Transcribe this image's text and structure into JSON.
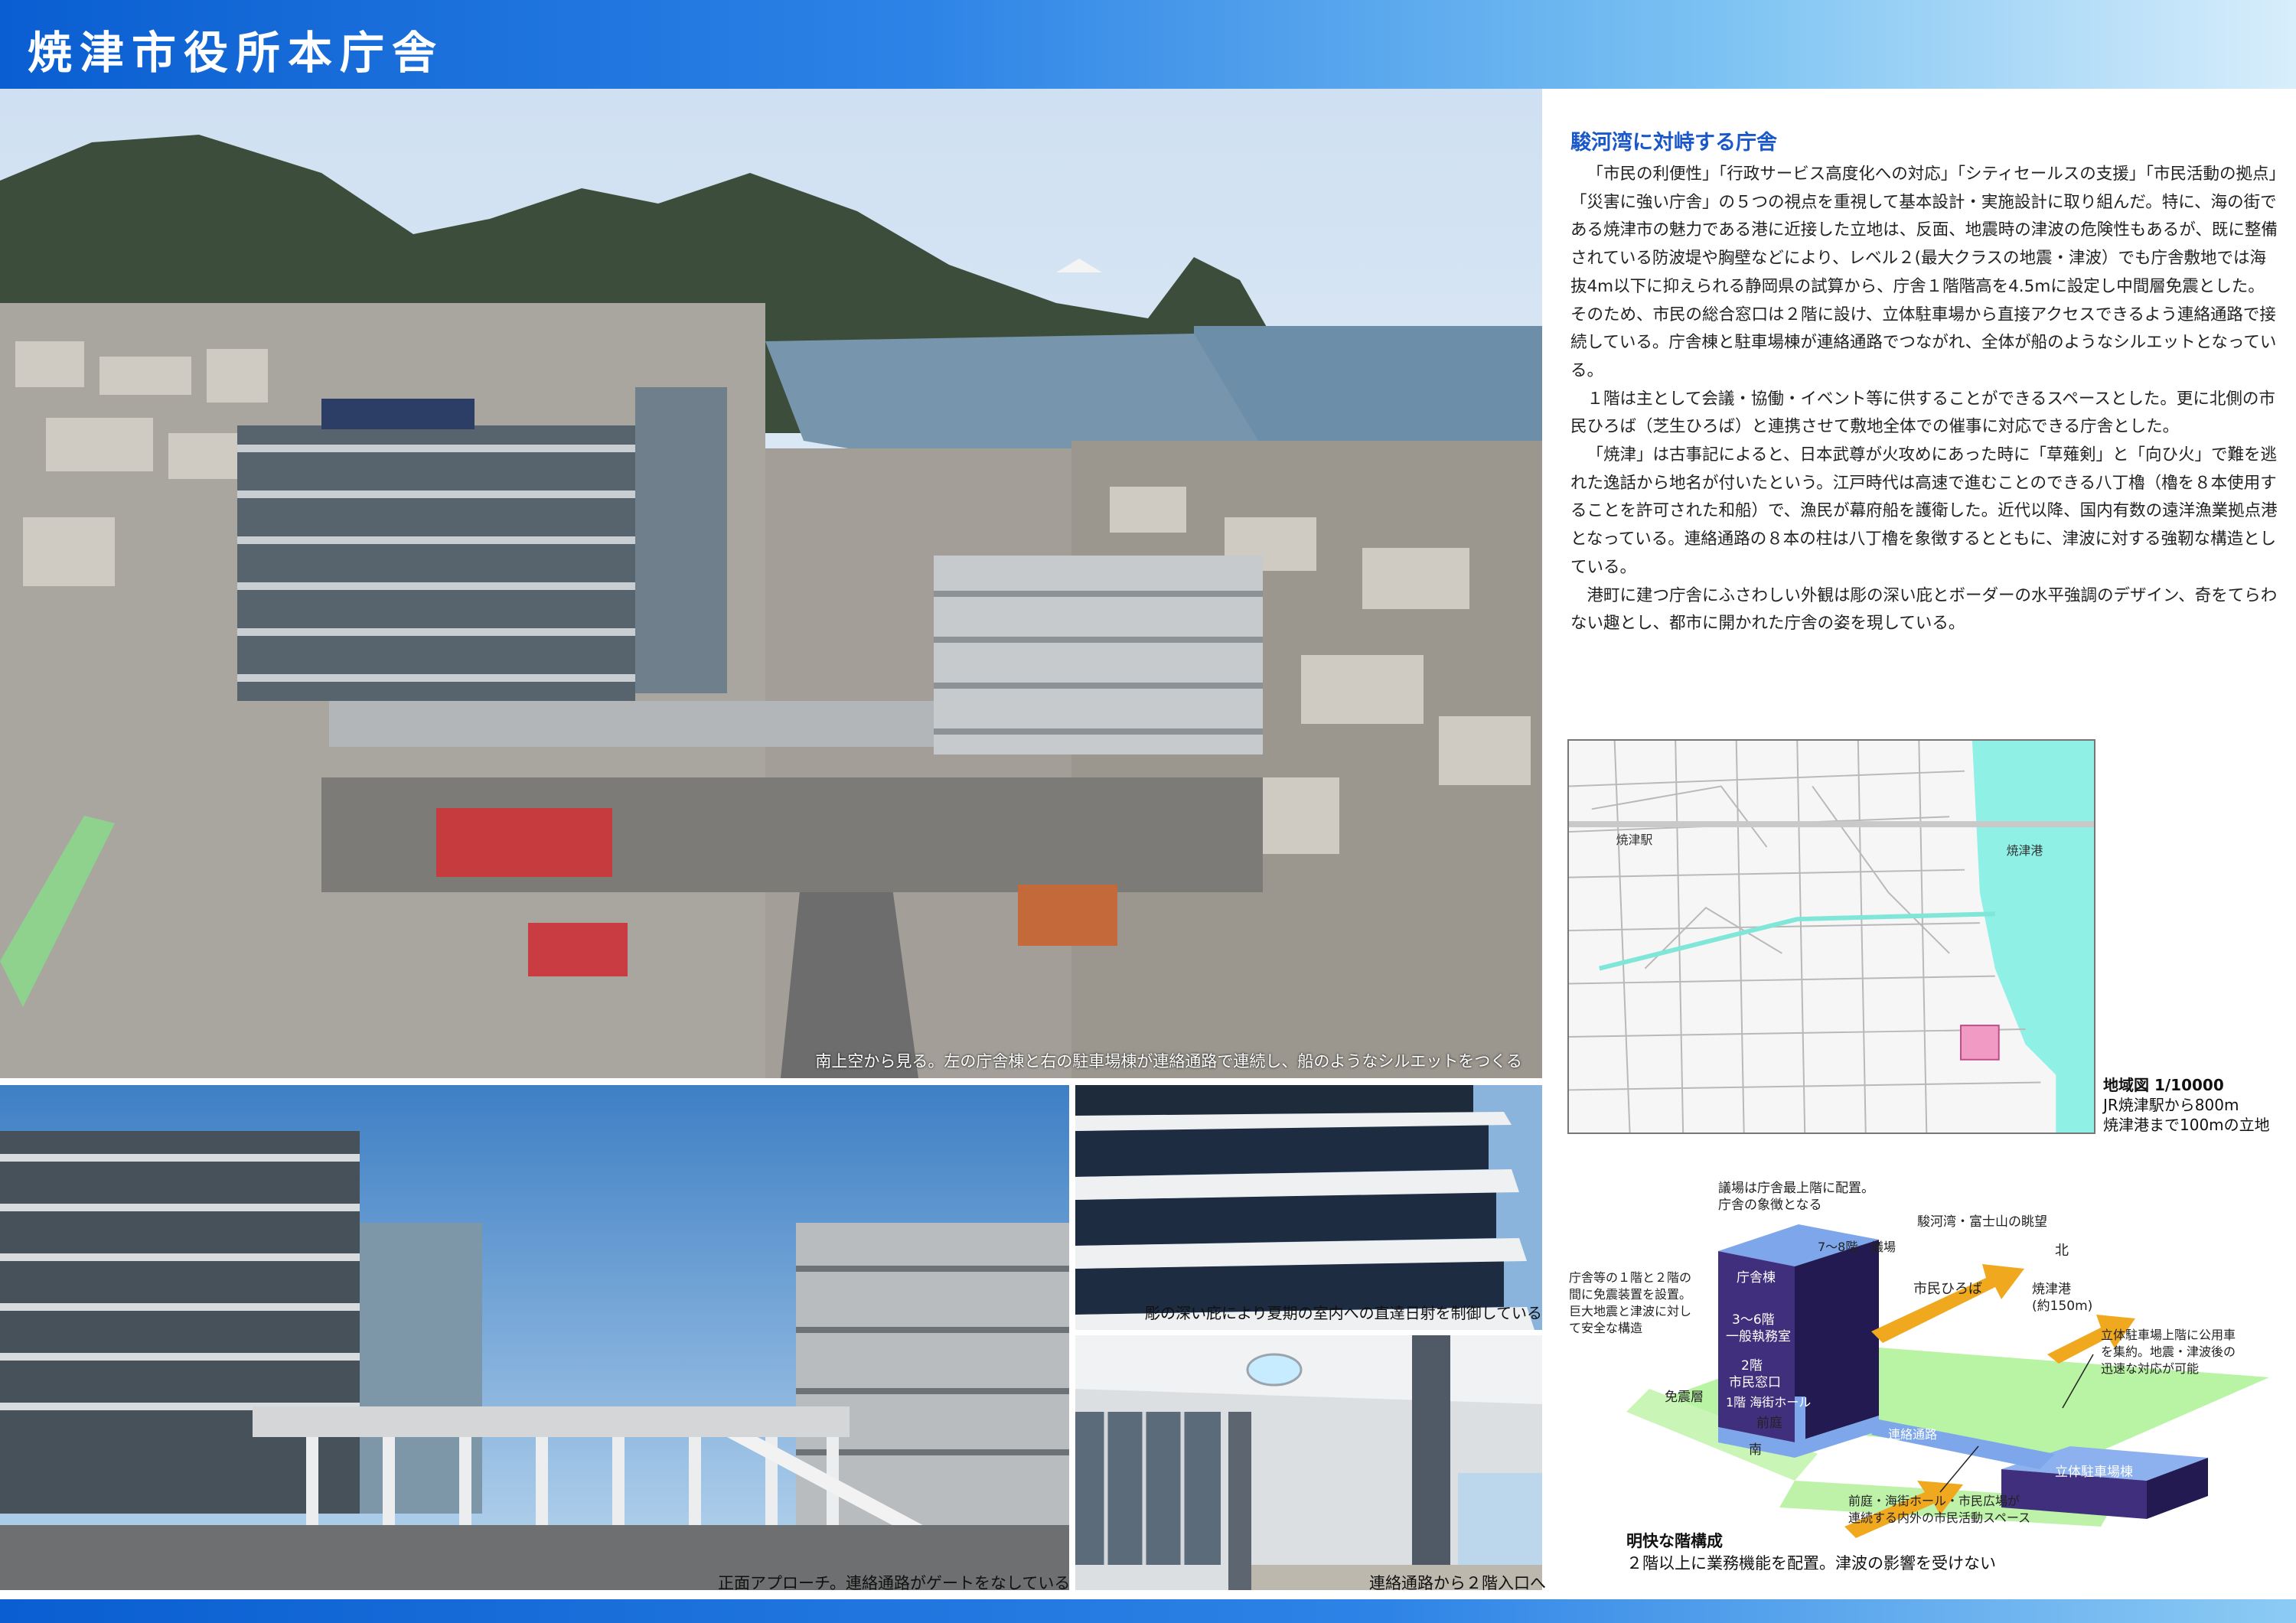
{
  "header": {
    "title": "焼津市役所本庁舎"
  },
  "photos": {
    "main_caption": "南上空から見る。左の庁舎棟と右の駐車場棟が連絡通路で連続し、船のようなシルエットをつくる",
    "front_caption": "正面アプローチ。連絡通路がゲートをなしている",
    "eaves_caption": "彫の深い庇により夏期の室内への直達日射を制御している",
    "corridor_caption": "連絡通路から２階入口へ"
  },
  "article": {
    "heading": "駿河湾に対峙する庁舎",
    "paragraphs": [
      "「市民の利便性」「行政サービス高度化への対応」「シティセールスの支援」「市民活動の拠点」「災害に強い庁舎」の５つの視点を重視して基本設計・実施設計に取り組んだ。特に、海の街である焼津市の魅力である港に近接した立地は、反面、地震時の津波の危険性もあるが、既に整備されている防波堤や胸壁などにより、レベル２(最大クラスの地震・津波）でも庁舎敷地では海抜4m以下に抑えられる静岡県の試算から、庁舎１階階高を4.5mに設定し中間層免震とした。そのため、市民の総合窓口は２階に設け、立体駐車場から直接アクセスできるよう連絡通路で接続している。庁舎棟と駐車場棟が連絡通路でつながれ、全体が船のようなシルエットとなっている。",
      "１階は主として会議・協働・イベント等に供することができるスペースとした。更に北側の市民ひろば（芝生ひろば）と連携させて敷地全体での催事に対応できる庁舎とした。",
      "「焼津」は古事記によると、日本武尊が火攻めにあった時に「草薙剣」と「向ひ火」で難を逃れた逸話から地名が付いたという。江戸時代は高速で進むことのできる八丁櫓（櫓を８本使用することを許可された和船）で、漁民が幕府船を護衛した。近代以降、国内有数の遠洋漁業拠点港となっている。連絡通路の８本の柱は八丁櫓を象徴するとともに、津波に対する強靭な構造としている。",
      "港町に建つ庁舎にふさわしい外観は彫の深い庇とボーダーの水平強調のデザイン、奇をてらわない趣とし、都市に開かれた庁舎の姿を現している。"
    ]
  },
  "map": {
    "label_station": "焼津駅",
    "label_port": "焼津港",
    "caption_title": "地域図 1/10000",
    "caption_line1": "JR焼津駅から800m",
    "caption_line2": "焼津港まで100mの立地"
  },
  "diagram": {
    "note_top": "議場は庁舎最上階に配置。",
    "note_top2": "庁舎の象徴となる",
    "view_label": "駿河湾・富士山の眺望",
    "north": "北",
    "south": "南",
    "floor_7_8": "7～8階",
    "assembly": "議場",
    "office_building": "庁舎棟",
    "citizen_square": "市民ひろば",
    "port": "焼津港",
    "port_distance": "(約150m)",
    "floor_3_6": "3～6階",
    "general_office": "一般執務室",
    "floor_2": "2階",
    "citizen_window": "市民窓口",
    "floor_1_hall": "1階  海街ホール",
    "isolation_layer": "免震層",
    "front_garden": "前庭",
    "corridor": "連絡通路",
    "parking": "立体駐車場棟",
    "note_left": [
      "庁舎等の１階と２階の",
      "間に免震装置を設置。",
      "巨大地震と津波に対し",
      "て安全な構造"
    ],
    "note_right": [
      "立体駐車場上階に公用車",
      "を集約。地震・津波後の",
      "迅速な対応が可能"
    ],
    "note_bottom": [
      "前庭・海街ホール・市民広場が",
      "連続する内外の市民活動スペース"
    ],
    "caption_title": "明快な階構成",
    "caption_text": "２階以上に業務機能を配置。津波の影響を受けない"
  },
  "colors": {
    "brand_blue": "#1a57c8",
    "accent_orange": "#f0a81e",
    "green_zone": "#b9f3a4",
    "building_purple": "#3f2f7c"
  }
}
